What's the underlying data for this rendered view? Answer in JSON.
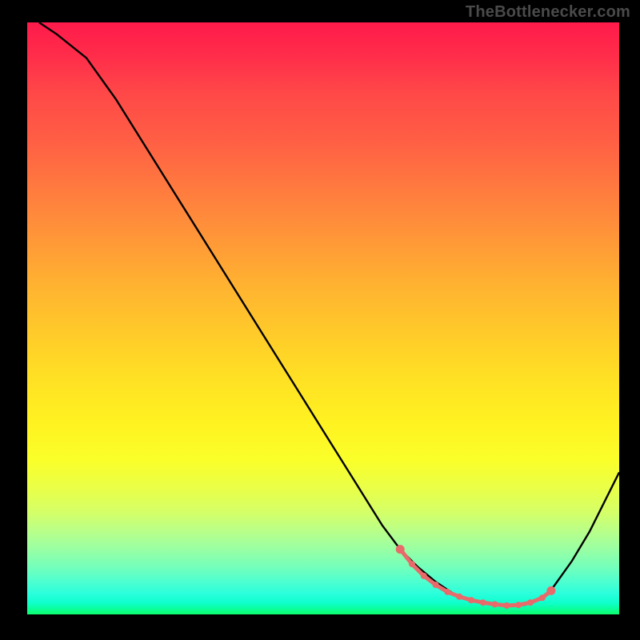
{
  "watermark": "TheBottlenecker.com",
  "chart_data": {
    "type": "line",
    "title": "",
    "xlabel": "",
    "ylabel": "",
    "xlim": [
      0,
      100
    ],
    "ylim": [
      0,
      100
    ],
    "series": [
      {
        "name": "curve",
        "color": "#000000",
        "x": [
          2,
          5,
          10,
          15,
          20,
          25,
          30,
          35,
          40,
          45,
          50,
          55,
          60,
          63,
          66,
          69,
          72,
          75,
          78,
          81,
          84,
          87,
          89,
          92,
          95,
          98,
          100
        ],
        "y": [
          100,
          98,
          94,
          87,
          79,
          71,
          63,
          55,
          47,
          39,
          31,
          23,
          15,
          11,
          8,
          5.5,
          3.5,
          2.4,
          1.8,
          1.5,
          1.6,
          2.6,
          4.8,
          9,
          14,
          20,
          24
        ]
      },
      {
        "name": "markers",
        "color": "#e86a6a",
        "style": "dots",
        "x": [
          63,
          65,
          67,
          69,
          71,
          73,
          75,
          77,
          79,
          81,
          83,
          85,
          87,
          88.5
        ],
        "y": [
          11,
          8.5,
          6.5,
          5,
          3.8,
          3,
          2.4,
          2,
          1.7,
          1.5,
          1.6,
          2.0,
          2.8,
          4.0
        ]
      }
    ],
    "gradient_stops": [
      {
        "pos": 0.0,
        "color": "#ff1a4b"
      },
      {
        "pos": 0.5,
        "color": "#ffd127"
      },
      {
        "pos": 0.75,
        "color": "#f6ff2e"
      },
      {
        "pos": 0.9,
        "color": "#8affaa"
      },
      {
        "pos": 1.0,
        "color": "#0dff6c"
      }
    ]
  }
}
